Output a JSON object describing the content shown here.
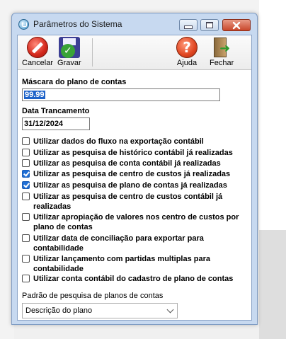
{
  "window": {
    "title": "Parâmetros do Sistema"
  },
  "toolbar": {
    "cancel_label": "Cancelar",
    "save_label": "Gravar",
    "help_label": "Ajuda",
    "close_label": "Fechar"
  },
  "form": {
    "mask_label": "Máscara do plano de contas",
    "mask_value": "99.99",
    "lock_date_label": "Data Trancamento",
    "lock_date_value": "31/12/2024",
    "options": [
      {
        "label": "Utilizar dados do fluxo na exportação contábil",
        "checked": false
      },
      {
        "label": "Utilizar as pesquisa de histórico contábil já realizadas",
        "checked": false
      },
      {
        "label": "Utilizar as pesquisa de conta contábil já realizadas",
        "checked": false
      },
      {
        "label": "Utilizar as pesquisa de centro de custos já realizadas",
        "checked": true
      },
      {
        "label": "Utilizar as pesquisa de plano de contas já realizadas",
        "checked": true
      },
      {
        "label": "Utilizar as pesquisa de centro de custos contábil já realizadas",
        "checked": false
      },
      {
        "label": "Utilizar apropiação de valores nos centro de custos por plano de contas",
        "checked": false
      },
      {
        "label": "Utilizar data de conciliação para exportar para contabilidade",
        "checked": false
      },
      {
        "label": "Utilizar lançamento com partidas multiplas para contabilidade",
        "checked": false
      },
      {
        "label": "Utilizar conta contábil do cadastro de plano de contas",
        "checked": false
      }
    ],
    "search_default_label": "Padrão de pesquisa de planos de contas",
    "search_default_value": "Descrição do plano"
  },
  "icons": {
    "window": "app-icon",
    "cancel": "cancel-icon",
    "save": "save-icon",
    "help": "help-icon",
    "close": "exit-door-icon"
  },
  "colors": {
    "checked": "#1f6fd6",
    "selection": "#1e63c9",
    "titlebar": "#c7d9f0"
  }
}
